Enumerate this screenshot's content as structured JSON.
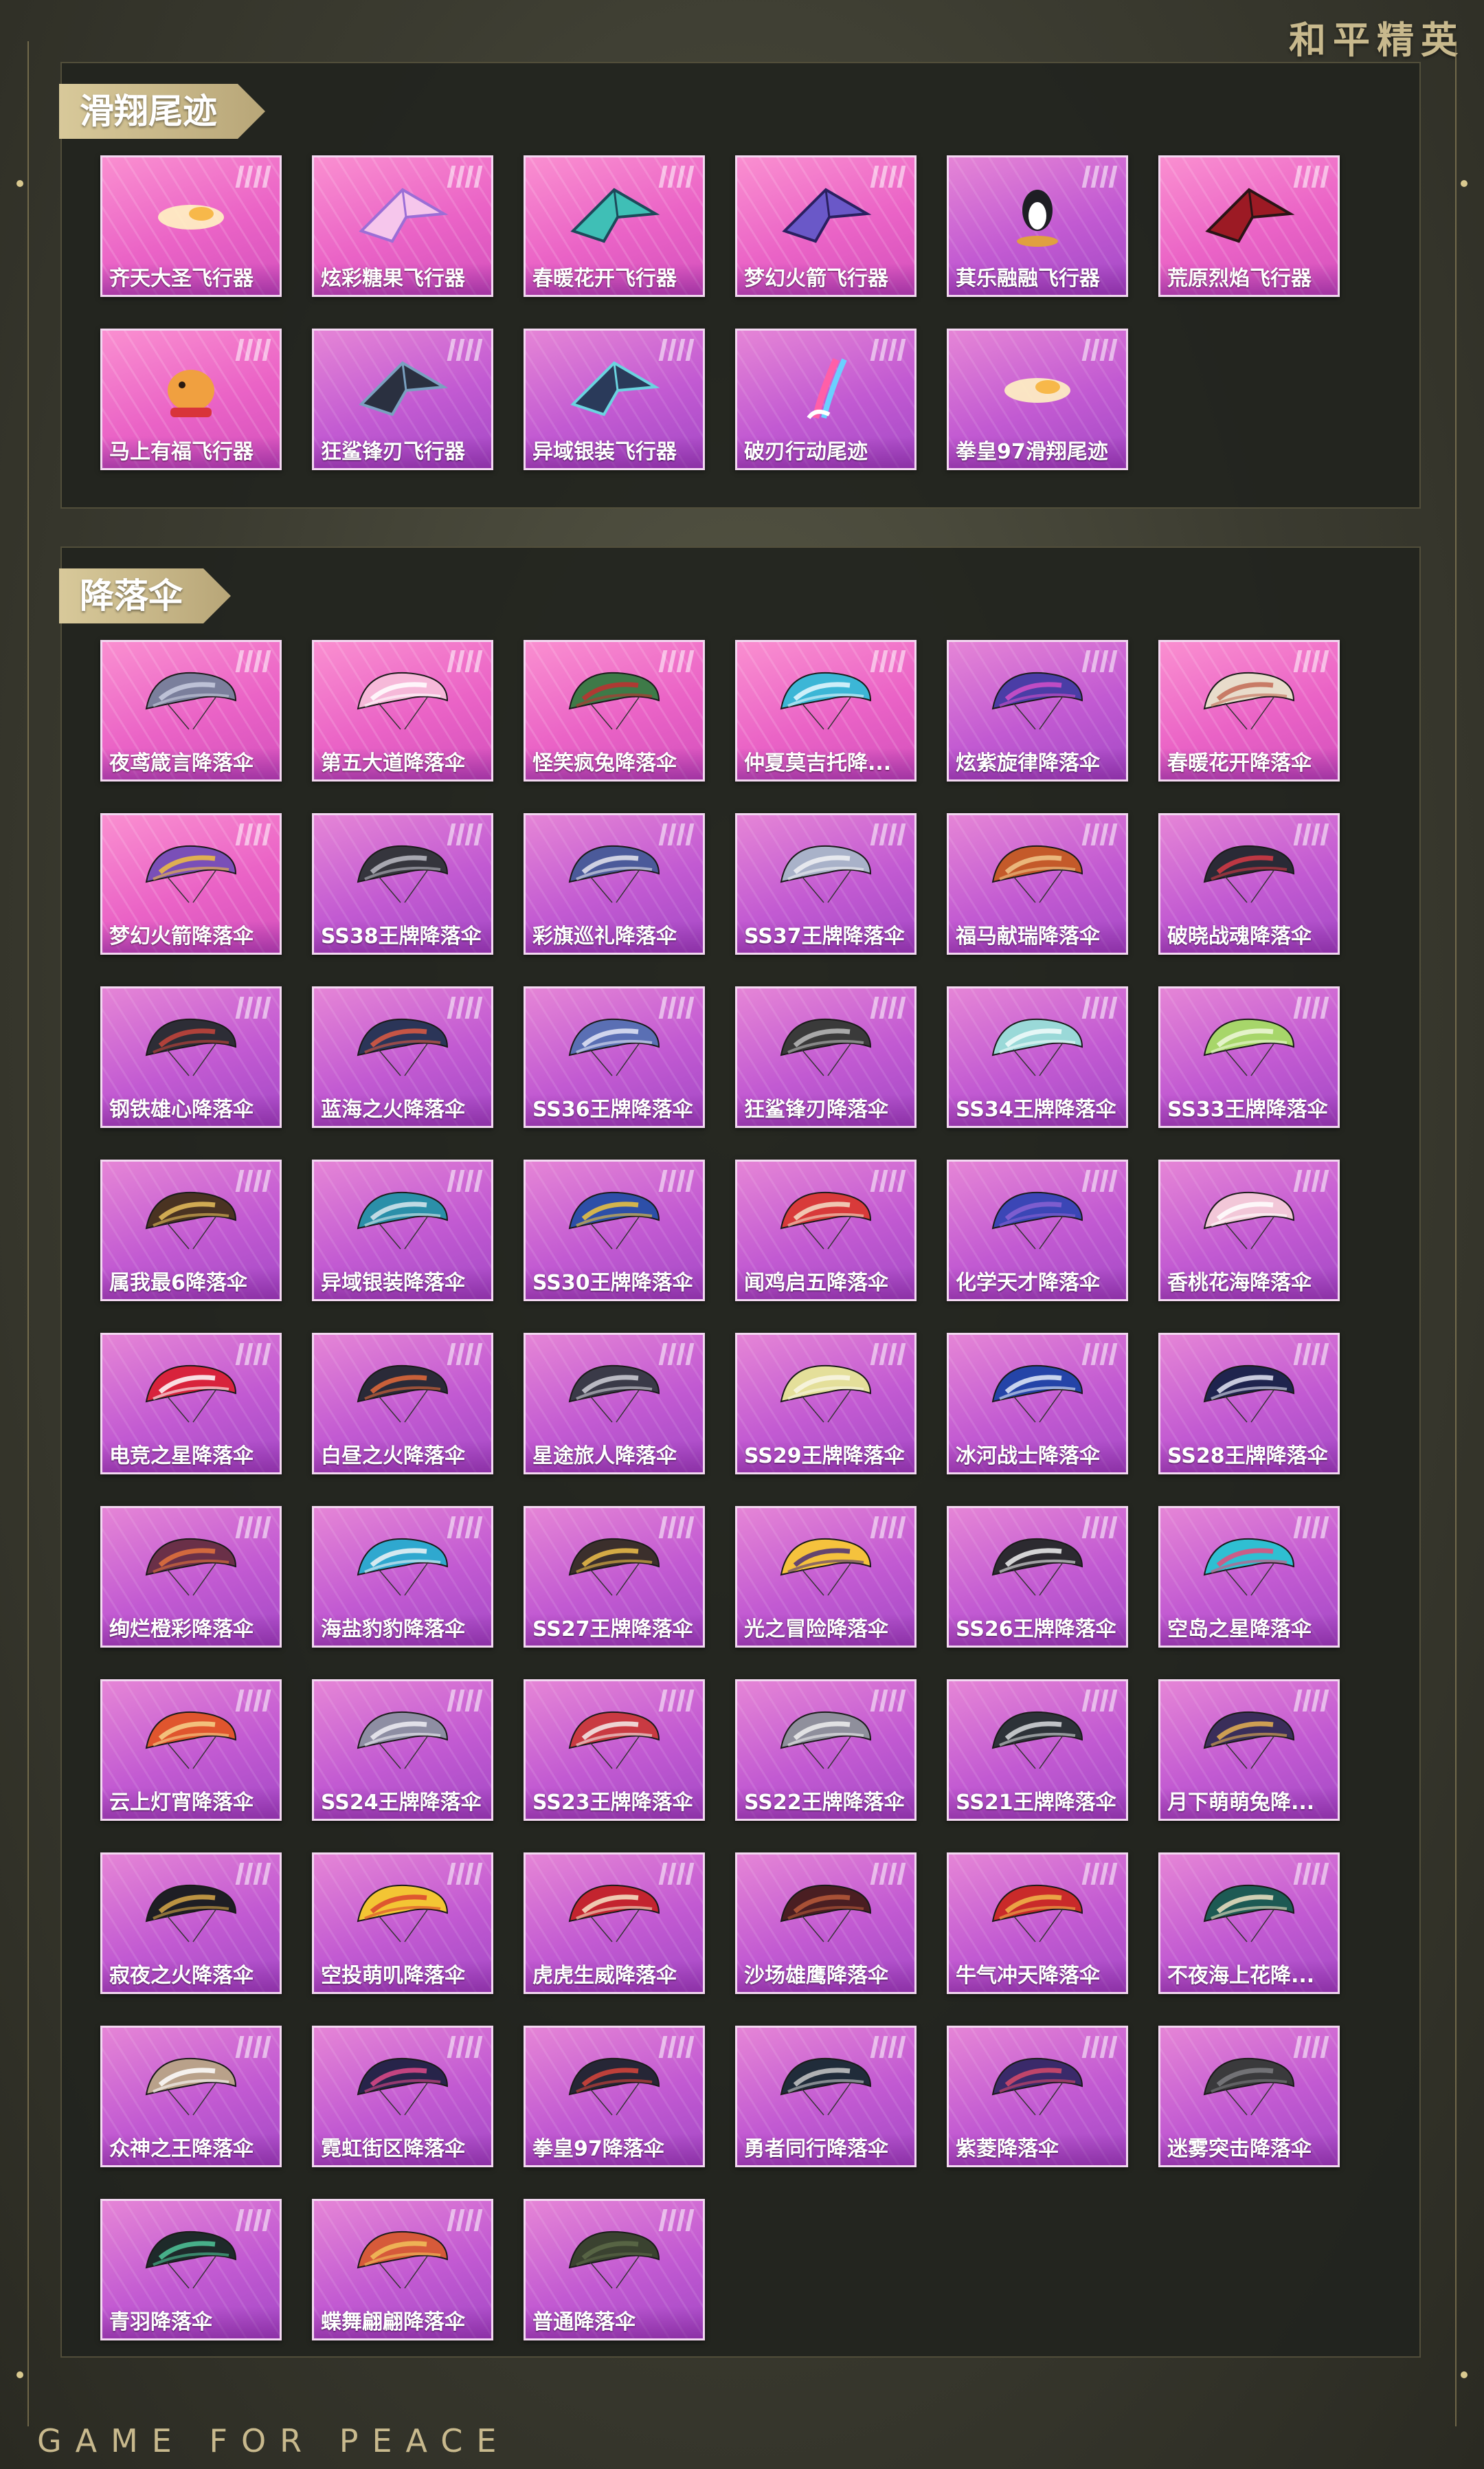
{
  "brand_title": "和平精英",
  "brand_footer": "GAME FOR PEACE",
  "colors": {
    "card_hot": "#ea63c6",
    "card_purple": "#c25ad2",
    "accent_gold": "#c8b98d"
  },
  "sections": [
    {
      "title": "滑翔尾迹",
      "items": [
        {
          "label": "齐天大圣飞行器",
          "icon": "flame-trail-icon",
          "hot": true
        },
        {
          "label": "炫彩糖果飞行器",
          "icon": "candy-glider-icon",
          "hot": true
        },
        {
          "label": "春暖花开飞行器",
          "icon": "butterfly-glider-icon",
          "hot": true
        },
        {
          "label": "梦幻火箭飞行器",
          "icon": "rocket-glider-icon",
          "hot": true
        },
        {
          "label": "萁乐融融飞行器",
          "icon": "penguin-glider-icon",
          "hot": false
        },
        {
          "label": "荒原烈焰飞行器",
          "icon": "dragon-glider-icon",
          "hot": true
        },
        {
          "label": "马上有福飞行器",
          "icon": "horse-glider-icon",
          "hot": true
        },
        {
          "label": "狂鲨锋刃飞行器",
          "icon": "shark-glider-icon",
          "hot": false
        },
        {
          "label": "异域银装飞行器",
          "icon": "wing-glider-icon",
          "hot": false
        },
        {
          "label": "破刃行动尾迹",
          "icon": "rainbow-trail-icon",
          "hot": false
        },
        {
          "label": "拳皇97滑翔尾迹",
          "icon": "flame-trail-icon",
          "hot": false
        }
      ]
    },
    {
      "title": "降落伞",
      "items": [
        {
          "label": "夜鸢箴言降落伞",
          "icon": "parachute-icon",
          "c1": "#7b7f9c",
          "c2": "#c9cde0",
          "hot": true
        },
        {
          "label": "第五大道降落伞",
          "icon": "parachute-icon",
          "c1": "#f6b9d9",
          "c2": "#ffffff",
          "hot": true
        },
        {
          "label": "怪笑疯兔降落伞",
          "icon": "parachute-icon",
          "c1": "#3e7a48",
          "c2": "#c22f30",
          "hot": true
        },
        {
          "label": "仲夏莫吉托降...",
          "icon": "parachute-icon",
          "c1": "#3cb6d6",
          "c2": "#e8f9ff",
          "hot": true
        },
        {
          "label": "炫紫旋律降落伞",
          "icon": "parachute-icon",
          "c1": "#4a3da6",
          "c2": "#d44fc9",
          "hot": false
        },
        {
          "label": "春暖花开降落伞",
          "icon": "parachute-icon",
          "c1": "#e8dccb",
          "c2": "#c26a55",
          "hot": true
        },
        {
          "label": "梦幻火箭降落伞",
          "icon": "parachute-icon",
          "c1": "#7a4fb8",
          "c2": "#f1c040",
          "hot": true
        },
        {
          "label": "SS38王牌降落伞",
          "icon": "parachute-icon",
          "c1": "#35353d",
          "c2": "#bbbbc4",
          "hot": false
        },
        {
          "label": "彩旗巡礼降落伞",
          "icon": "parachute-icon",
          "c1": "#4b5a9a",
          "c2": "#e6e6ef",
          "hot": false
        },
        {
          "label": "SS37王牌降落伞",
          "icon": "parachute-icon",
          "c1": "#a9b2c9",
          "c2": "#f1f1f4",
          "hot": false
        },
        {
          "label": "福马献瑞降落伞",
          "icon": "parachute-icon",
          "c1": "#c45a2a",
          "c2": "#f1c88b",
          "hot": false
        },
        {
          "label": "破晓战魂降落伞",
          "icon": "parachute-icon",
          "c1": "#2a2a36",
          "c2": "#d83a45",
          "hot": false
        },
        {
          "label": "钢铁雄心降落伞",
          "icon": "parachute-icon",
          "c1": "#2d2d36",
          "c2": "#c8453b",
          "hot": false
        },
        {
          "label": "蓝海之火降落伞",
          "icon": "parachute-icon",
          "c1": "#2b3558",
          "c2": "#e05a42",
          "hot": false
        },
        {
          "label": "SS36王牌降落伞",
          "icon": "parachute-icon",
          "c1": "#5a6fb4",
          "c2": "#e5e8f7",
          "hot": false
        },
        {
          "label": "狂鲨锋刃降落伞",
          "icon": "parachute-icon",
          "c1": "#3a3a3a",
          "c2": "#bcbcbc",
          "hot": false
        },
        {
          "label": "SS34王牌降落伞",
          "icon": "parachute-icon",
          "c1": "#9ad9d8",
          "c2": "#f2fbfb",
          "hot": false
        },
        {
          "label": "SS33王牌降落伞",
          "icon": "parachute-icon",
          "c1": "#a7d66a",
          "c2": "#eef8d9",
          "hot": false
        },
        {
          "label": "属我最6降落伞",
          "icon": "parachute-icon",
          "c1": "#4a3322",
          "c2": "#e7c05c",
          "hot": false
        },
        {
          "label": "异域银装降落伞",
          "icon": "parachute-icon",
          "c1": "#2b8fa9",
          "c2": "#dbe9ef",
          "hot": false
        },
        {
          "label": "SS30王牌降落伞",
          "icon": "parachute-icon",
          "c1": "#2d4fa8",
          "c2": "#f1c63d",
          "hot": false
        },
        {
          "label": "闻鸡启五降落伞",
          "icon": "parachute-icon",
          "c1": "#d83a3a",
          "c2": "#f4e1c8",
          "hot": false
        },
        {
          "label": "化学天才降落伞",
          "icon": "parachute-icon",
          "c1": "#3b46b6",
          "c2": "#8a61d4",
          "hot": false
        },
        {
          "label": "香桃花海降落伞",
          "icon": "parachute-icon",
          "c1": "#f2c7d8",
          "c2": "#ffffff",
          "hot": false
        },
        {
          "label": "电竞之星降落伞",
          "icon": "parachute-icon",
          "c1": "#d8233c",
          "c2": "#ffffff",
          "hot": false
        },
        {
          "label": "白昼之火降落伞",
          "icon": "parachute-icon",
          "c1": "#2a2a38",
          "c2": "#e56a3a",
          "hot": false
        },
        {
          "label": "星途旅人降落伞",
          "icon": "parachute-icon",
          "c1": "#3a3a48",
          "c2": "#d0d0d8",
          "hot": false
        },
        {
          "label": "SS29王牌降落伞",
          "icon": "parachute-icon",
          "c1": "#e4df9a",
          "c2": "#f9f7e5",
          "hot": false
        },
        {
          "label": "冰河战士降落伞",
          "icon": "parachute-icon",
          "c1": "#2444a8",
          "c2": "#e4ecfa",
          "hot": false
        },
        {
          "label": "SS28王牌降落伞",
          "icon": "parachute-icon",
          "c1": "#1f244e",
          "c2": "#e6e8f7",
          "hot": false
        },
        {
          "label": "绚烂橙彩降落伞",
          "icon": "parachute-icon",
          "c1": "#6a3048",
          "c2": "#e4733d",
          "hot": false
        },
        {
          "label": "海盐豹豹降落伞",
          "icon": "parachute-icon",
          "c1": "#2fa8cf",
          "c2": "#f1f4f6",
          "hot": false
        },
        {
          "label": "SS27王牌降落伞",
          "icon": "parachute-icon",
          "c1": "#3b2f2c",
          "c2": "#f0c04a",
          "hot": false
        },
        {
          "label": "光之冒险降落伞",
          "icon": "parachute-icon",
          "c1": "#f5c23d",
          "c2": "#4a2f78",
          "hot": false
        },
        {
          "label": "SS26王牌降落伞",
          "icon": "parachute-icon",
          "c1": "#2c2a30",
          "c2": "#f2f2f2",
          "hot": false
        },
        {
          "label": "空岛之星降落伞",
          "icon": "parachute-icon",
          "c1": "#2fbfd2",
          "c2": "#e54b7a",
          "hot": false
        },
        {
          "label": "云上灯宵降落伞",
          "icon": "parachute-icon",
          "c1": "#e0552e",
          "c2": "#f6d38a",
          "hot": false
        },
        {
          "label": "SS24王牌降落伞",
          "icon": "parachute-icon",
          "c1": "#8e8ea3",
          "c2": "#f0eff5",
          "hot": false
        },
        {
          "label": "SS23王牌降落伞",
          "icon": "parachute-icon",
          "c1": "#c93a42",
          "c2": "#f4f0ec",
          "hot": false
        },
        {
          "label": "SS22王牌降落伞",
          "icon": "parachute-icon",
          "c1": "#8f8f9c",
          "c2": "#f0f0f0",
          "hot": false
        },
        {
          "label": "SS21王牌降落伞",
          "icon": "parachute-icon",
          "c1": "#2d3238",
          "c2": "#d9dcde",
          "hot": false
        },
        {
          "label": "月下萌萌兔降...",
          "icon": "parachute-icon",
          "c1": "#3a2e5a",
          "c2": "#e7b152",
          "hot": false
        },
        {
          "label": "寂夜之火降落伞",
          "icon": "parachute-icon",
          "c1": "#1e1e24",
          "c2": "#d7a848",
          "hot": false
        },
        {
          "label": "空投萌叽降落伞",
          "icon": "parachute-icon",
          "c1": "#f3c534",
          "c2": "#d9432f",
          "hot": false
        },
        {
          "label": "虎虎生威降落伞",
          "icon": "parachute-icon",
          "c1": "#c3242f",
          "c2": "#f7e6c8",
          "hot": false
        },
        {
          "label": "沙场雄鹰降落伞",
          "icon": "parachute-icon",
          "c1": "#4a1e22",
          "c2": "#b85a3a",
          "hot": false
        },
        {
          "label": "牛气冲天降落伞",
          "icon": "parachute-icon",
          "c1": "#c92a2a",
          "c2": "#f1b84a",
          "hot": false
        },
        {
          "label": "不夜海上花降...",
          "icon": "parachute-icon",
          "c1": "#1d5a54",
          "c2": "#f0e4c4",
          "hot": false
        },
        {
          "label": "众神之王降落伞",
          "icon": "parachute-icon",
          "c1": "#b9a18a",
          "c2": "#ffffff",
          "hot": false
        },
        {
          "label": "霓虹街区降落伞",
          "icon": "parachute-icon",
          "c1": "#27244a",
          "c2": "#e04a8a",
          "hot": false
        },
        {
          "label": "拳皇97降落伞",
          "icon": "parachute-icon",
          "c1": "#262636",
          "c2": "#d9453b",
          "hot": false
        },
        {
          "label": "勇者同行降落伞",
          "icon": "parachute-icon",
          "c1": "#202c3a",
          "c2": "#c9c9c9",
          "hot": false
        },
        {
          "label": "紫菱降落伞",
          "icon": "parachute-icon",
          "c1": "#3a2a6a",
          "c2": "#d84a6a",
          "hot": false
        },
        {
          "label": "迷雾突击降落伞",
          "icon": "parachute-icon",
          "c1": "#3a3a3c",
          "c2": "#7d7d80",
          "hot": false
        },
        {
          "label": "青羽降落伞",
          "icon": "parachute-icon",
          "c1": "#1e2a2a",
          "c2": "#4fc79a",
          "hot": false
        },
        {
          "label": "蝶舞翩翩降落伞",
          "icon": "parachute-icon",
          "c1": "#d65a3a",
          "c2": "#f2c25a",
          "hot": false
        },
        {
          "label": "普通降落伞",
          "icon": "parachute-icon",
          "c1": "#3a4230",
          "c2": "#5d6a48",
          "hot": false
        }
      ]
    }
  ]
}
